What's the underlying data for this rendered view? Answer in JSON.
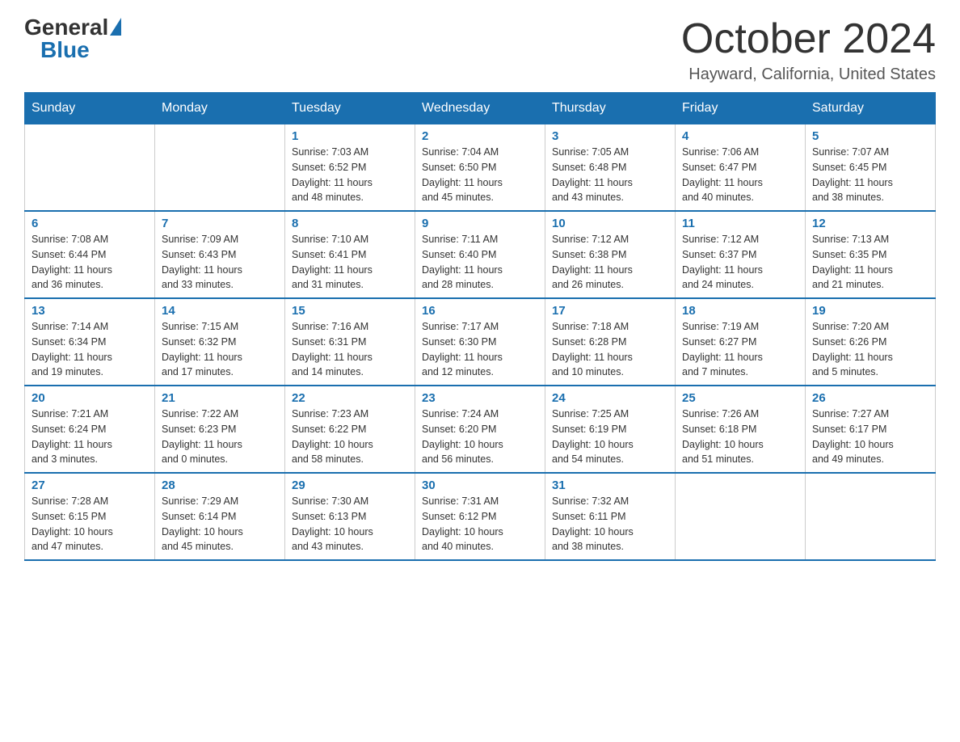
{
  "logo": {
    "general": "General",
    "blue": "Blue",
    "triangle": true
  },
  "title": "October 2024",
  "subtitle": "Hayward, California, United States",
  "days_of_week": [
    "Sunday",
    "Monday",
    "Tuesday",
    "Wednesday",
    "Thursday",
    "Friday",
    "Saturday"
  ],
  "weeks": [
    [
      {
        "day": "",
        "info": ""
      },
      {
        "day": "",
        "info": ""
      },
      {
        "day": "1",
        "info": "Sunrise: 7:03 AM\nSunset: 6:52 PM\nDaylight: 11 hours\nand 48 minutes."
      },
      {
        "day": "2",
        "info": "Sunrise: 7:04 AM\nSunset: 6:50 PM\nDaylight: 11 hours\nand 45 minutes."
      },
      {
        "day": "3",
        "info": "Sunrise: 7:05 AM\nSunset: 6:48 PM\nDaylight: 11 hours\nand 43 minutes."
      },
      {
        "day": "4",
        "info": "Sunrise: 7:06 AM\nSunset: 6:47 PM\nDaylight: 11 hours\nand 40 minutes."
      },
      {
        "day": "5",
        "info": "Sunrise: 7:07 AM\nSunset: 6:45 PM\nDaylight: 11 hours\nand 38 minutes."
      }
    ],
    [
      {
        "day": "6",
        "info": "Sunrise: 7:08 AM\nSunset: 6:44 PM\nDaylight: 11 hours\nand 36 minutes."
      },
      {
        "day": "7",
        "info": "Sunrise: 7:09 AM\nSunset: 6:43 PM\nDaylight: 11 hours\nand 33 minutes."
      },
      {
        "day": "8",
        "info": "Sunrise: 7:10 AM\nSunset: 6:41 PM\nDaylight: 11 hours\nand 31 minutes."
      },
      {
        "day": "9",
        "info": "Sunrise: 7:11 AM\nSunset: 6:40 PM\nDaylight: 11 hours\nand 28 minutes."
      },
      {
        "day": "10",
        "info": "Sunrise: 7:12 AM\nSunset: 6:38 PM\nDaylight: 11 hours\nand 26 minutes."
      },
      {
        "day": "11",
        "info": "Sunrise: 7:12 AM\nSunset: 6:37 PM\nDaylight: 11 hours\nand 24 minutes."
      },
      {
        "day": "12",
        "info": "Sunrise: 7:13 AM\nSunset: 6:35 PM\nDaylight: 11 hours\nand 21 minutes."
      }
    ],
    [
      {
        "day": "13",
        "info": "Sunrise: 7:14 AM\nSunset: 6:34 PM\nDaylight: 11 hours\nand 19 minutes."
      },
      {
        "day": "14",
        "info": "Sunrise: 7:15 AM\nSunset: 6:32 PM\nDaylight: 11 hours\nand 17 minutes."
      },
      {
        "day": "15",
        "info": "Sunrise: 7:16 AM\nSunset: 6:31 PM\nDaylight: 11 hours\nand 14 minutes."
      },
      {
        "day": "16",
        "info": "Sunrise: 7:17 AM\nSunset: 6:30 PM\nDaylight: 11 hours\nand 12 minutes."
      },
      {
        "day": "17",
        "info": "Sunrise: 7:18 AM\nSunset: 6:28 PM\nDaylight: 11 hours\nand 10 minutes."
      },
      {
        "day": "18",
        "info": "Sunrise: 7:19 AM\nSunset: 6:27 PM\nDaylight: 11 hours\nand 7 minutes."
      },
      {
        "day": "19",
        "info": "Sunrise: 7:20 AM\nSunset: 6:26 PM\nDaylight: 11 hours\nand 5 minutes."
      }
    ],
    [
      {
        "day": "20",
        "info": "Sunrise: 7:21 AM\nSunset: 6:24 PM\nDaylight: 11 hours\nand 3 minutes."
      },
      {
        "day": "21",
        "info": "Sunrise: 7:22 AM\nSunset: 6:23 PM\nDaylight: 11 hours\nand 0 minutes."
      },
      {
        "day": "22",
        "info": "Sunrise: 7:23 AM\nSunset: 6:22 PM\nDaylight: 10 hours\nand 58 minutes."
      },
      {
        "day": "23",
        "info": "Sunrise: 7:24 AM\nSunset: 6:20 PM\nDaylight: 10 hours\nand 56 minutes."
      },
      {
        "day": "24",
        "info": "Sunrise: 7:25 AM\nSunset: 6:19 PM\nDaylight: 10 hours\nand 54 minutes."
      },
      {
        "day": "25",
        "info": "Sunrise: 7:26 AM\nSunset: 6:18 PM\nDaylight: 10 hours\nand 51 minutes."
      },
      {
        "day": "26",
        "info": "Sunrise: 7:27 AM\nSunset: 6:17 PM\nDaylight: 10 hours\nand 49 minutes."
      }
    ],
    [
      {
        "day": "27",
        "info": "Sunrise: 7:28 AM\nSunset: 6:15 PM\nDaylight: 10 hours\nand 47 minutes."
      },
      {
        "day": "28",
        "info": "Sunrise: 7:29 AM\nSunset: 6:14 PM\nDaylight: 10 hours\nand 45 minutes."
      },
      {
        "day": "29",
        "info": "Sunrise: 7:30 AM\nSunset: 6:13 PM\nDaylight: 10 hours\nand 43 minutes."
      },
      {
        "day": "30",
        "info": "Sunrise: 7:31 AM\nSunset: 6:12 PM\nDaylight: 10 hours\nand 40 minutes."
      },
      {
        "day": "31",
        "info": "Sunrise: 7:32 AM\nSunset: 6:11 PM\nDaylight: 10 hours\nand 38 minutes."
      },
      {
        "day": "",
        "info": ""
      },
      {
        "day": "",
        "info": ""
      }
    ]
  ]
}
